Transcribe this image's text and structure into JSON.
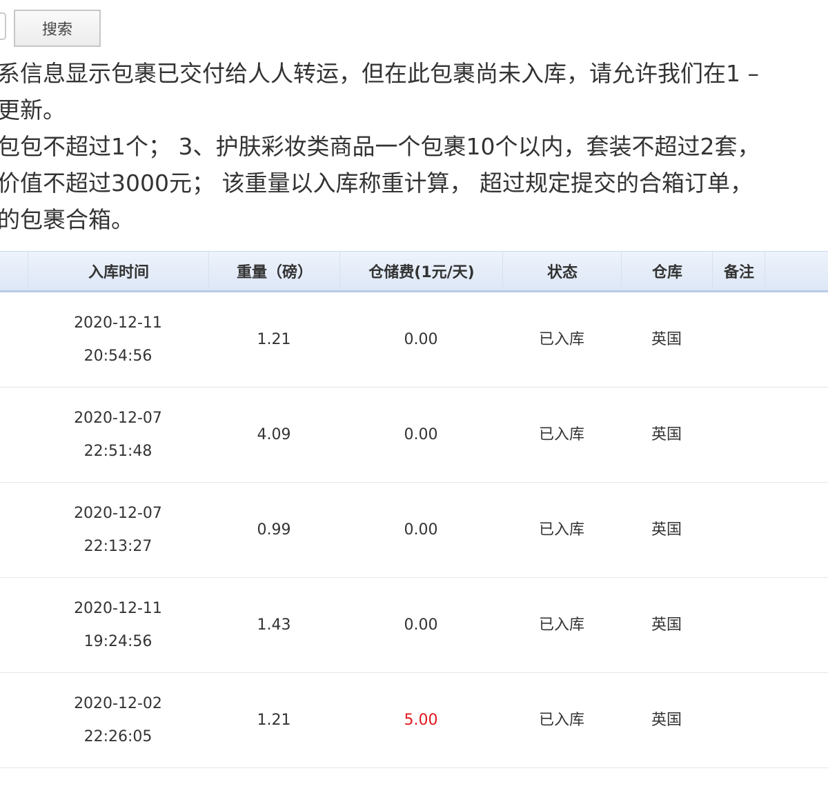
{
  "search": {
    "button_label": "搜索"
  },
  "notice": {
    "lines": [
      "系信息显示包裹已交付给人人转运，但在此包裹尚未入库，请允许我们在1 –",
      "更新。",
      "包包不超过1个；  3、护肤彩妆类商品一个包裹10个以内，套装不超过2套，",
      "价值不超过3000元；  该重量以入库称重计算，  超过规定提交的合箱订单，",
      "的包裹合箱。"
    ]
  },
  "table": {
    "headers": {
      "time": "入库时间",
      "weight": "重量（磅）",
      "fee": "仓储费(1元/天)",
      "status": "状态",
      "warehouse": "仓库",
      "note": "备注"
    },
    "rows": [
      {
        "date": "2020-12-11",
        "clock": "20:54:56",
        "weight": "1.21",
        "fee": "0.00",
        "status": "已入库",
        "warehouse": "英国",
        "note": ""
      },
      {
        "date": "2020-12-07",
        "clock": "22:51:48",
        "weight": "4.09",
        "fee": "0.00",
        "status": "已入库",
        "warehouse": "英国",
        "note": ""
      },
      {
        "date": "2020-12-07",
        "clock": "22:13:27",
        "weight": "0.99",
        "fee": "0.00",
        "status": "已入库",
        "warehouse": "英国",
        "note": ""
      },
      {
        "date": "2020-12-11",
        "clock": "19:24:56",
        "weight": "1.43",
        "fee": "0.00",
        "status": "已入库",
        "warehouse": "英国",
        "note": ""
      },
      {
        "date": "2020-12-02",
        "clock": "22:26:05",
        "weight": "1.21",
        "fee": "5.00",
        "status": "已入库",
        "warehouse": "英国",
        "note": ""
      }
    ]
  },
  "colors": {
    "fee_highlight": "#e0191e",
    "header_bg": "#dde7f6"
  }
}
